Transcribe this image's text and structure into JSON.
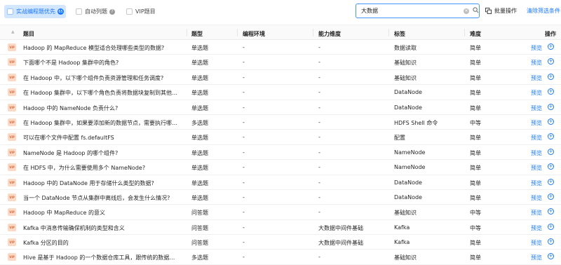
{
  "filters": {
    "practical_first": {
      "label": "实战编程题优先",
      "count": "65"
    },
    "auto_list": {
      "label": "自动列题"
    },
    "vip": {
      "label": "VIP题目"
    }
  },
  "search": {
    "value": "大数据"
  },
  "actions": {
    "batch": "批量操作",
    "clear": "清除筛选条件"
  },
  "columns": {
    "title": "题目",
    "type": "题型",
    "env": "编程环境",
    "ability": "能力维度",
    "tag": "标签",
    "difficulty": "难度",
    "action": "操作"
  },
  "vip_label": "VIP",
  "preview_label": "预览",
  "rows": [
    {
      "title": "Hadoop 的 MapReduce 模型适合处理哪些类型的数据?",
      "type": "单选题",
      "env": "-",
      "ability": "-",
      "tag": "数据读取",
      "difficulty": "简单"
    },
    {
      "title": "下面哪个不是 Hadoop 集群中的角色?",
      "type": "单选题",
      "env": "-",
      "ability": "-",
      "tag": "基础知识",
      "difficulty": "简单"
    },
    {
      "title": "在 Hadoop 中，以下哪个组件负责资源管理和任务调度?",
      "type": "单选题",
      "env": "-",
      "ability": "-",
      "tag": "基础知识",
      "difficulty": "简单"
    },
    {
      "title": "在 Hadoop 集群中，以下哪个角色负责将数据块复制到其他节点?",
      "type": "单选题",
      "env": "-",
      "ability": "-",
      "tag": "DataNode",
      "difficulty": "简单"
    },
    {
      "title": "Hadoop 中的 NameNode 负责什么?",
      "type": "单选题",
      "env": "-",
      "ability": "-",
      "tag": "DataNode",
      "difficulty": "简单"
    },
    {
      "title": "在 Hadoop 集群中，如果要添加新的数据节点，需要执行哪些步...",
      "type": "多选题",
      "env": "-",
      "ability": "-",
      "tag": "HDFS Shell 命令",
      "difficulty": "中等"
    },
    {
      "title": "可以在哪个文件中配置 fs.defaultFS",
      "type": "单选题",
      "env": "-",
      "ability": "-",
      "tag": "配置",
      "difficulty": "简单"
    },
    {
      "title": "NameNode 是 Hadoop 的哪个组件?",
      "type": "单选题",
      "env": "-",
      "ability": "-",
      "tag": "NameNode",
      "difficulty": "简单"
    },
    {
      "title": "在 HDFS 中，为什么需要使用多个 NameNode?",
      "type": "单选题",
      "env": "-",
      "ability": "-",
      "tag": "NameNode",
      "difficulty": "简单"
    },
    {
      "title": "Hadoop 中的 DataNode 用于存储什么类型的数据?",
      "type": "单选题",
      "env": "-",
      "ability": "-",
      "tag": "DataNode",
      "difficulty": "简单"
    },
    {
      "title": "当一个 DataNode 节点从集群中离线后，会发生什么情况?",
      "type": "单选题",
      "env": "-",
      "ability": "-",
      "tag": "DataNode",
      "difficulty": "简单"
    },
    {
      "title": "Hadoop 中 MapReduce 的意义",
      "type": "问答题",
      "env": "-",
      "ability": "-",
      "tag": "基础知识",
      "difficulty": "中等"
    },
    {
      "title": "Kafka 中消息传输确保机制的类型和含义",
      "type": "问答题",
      "env": "-",
      "ability": "大数据中间件基础",
      "tag": "Kafka",
      "difficulty": "中等"
    },
    {
      "title": "Kafka 分区的目的",
      "type": "问答题",
      "env": "-",
      "ability": "大数据中间件基础",
      "tag": "Kafka",
      "difficulty": "简单"
    },
    {
      "title": "Hive 是基于 Hadoop 的一个数据仓库工具，跟传统的数据库相比...",
      "type": "多选题",
      "env": "-",
      "ability": "-",
      "tag": "基础知识",
      "difficulty": "简单"
    }
  ]
}
